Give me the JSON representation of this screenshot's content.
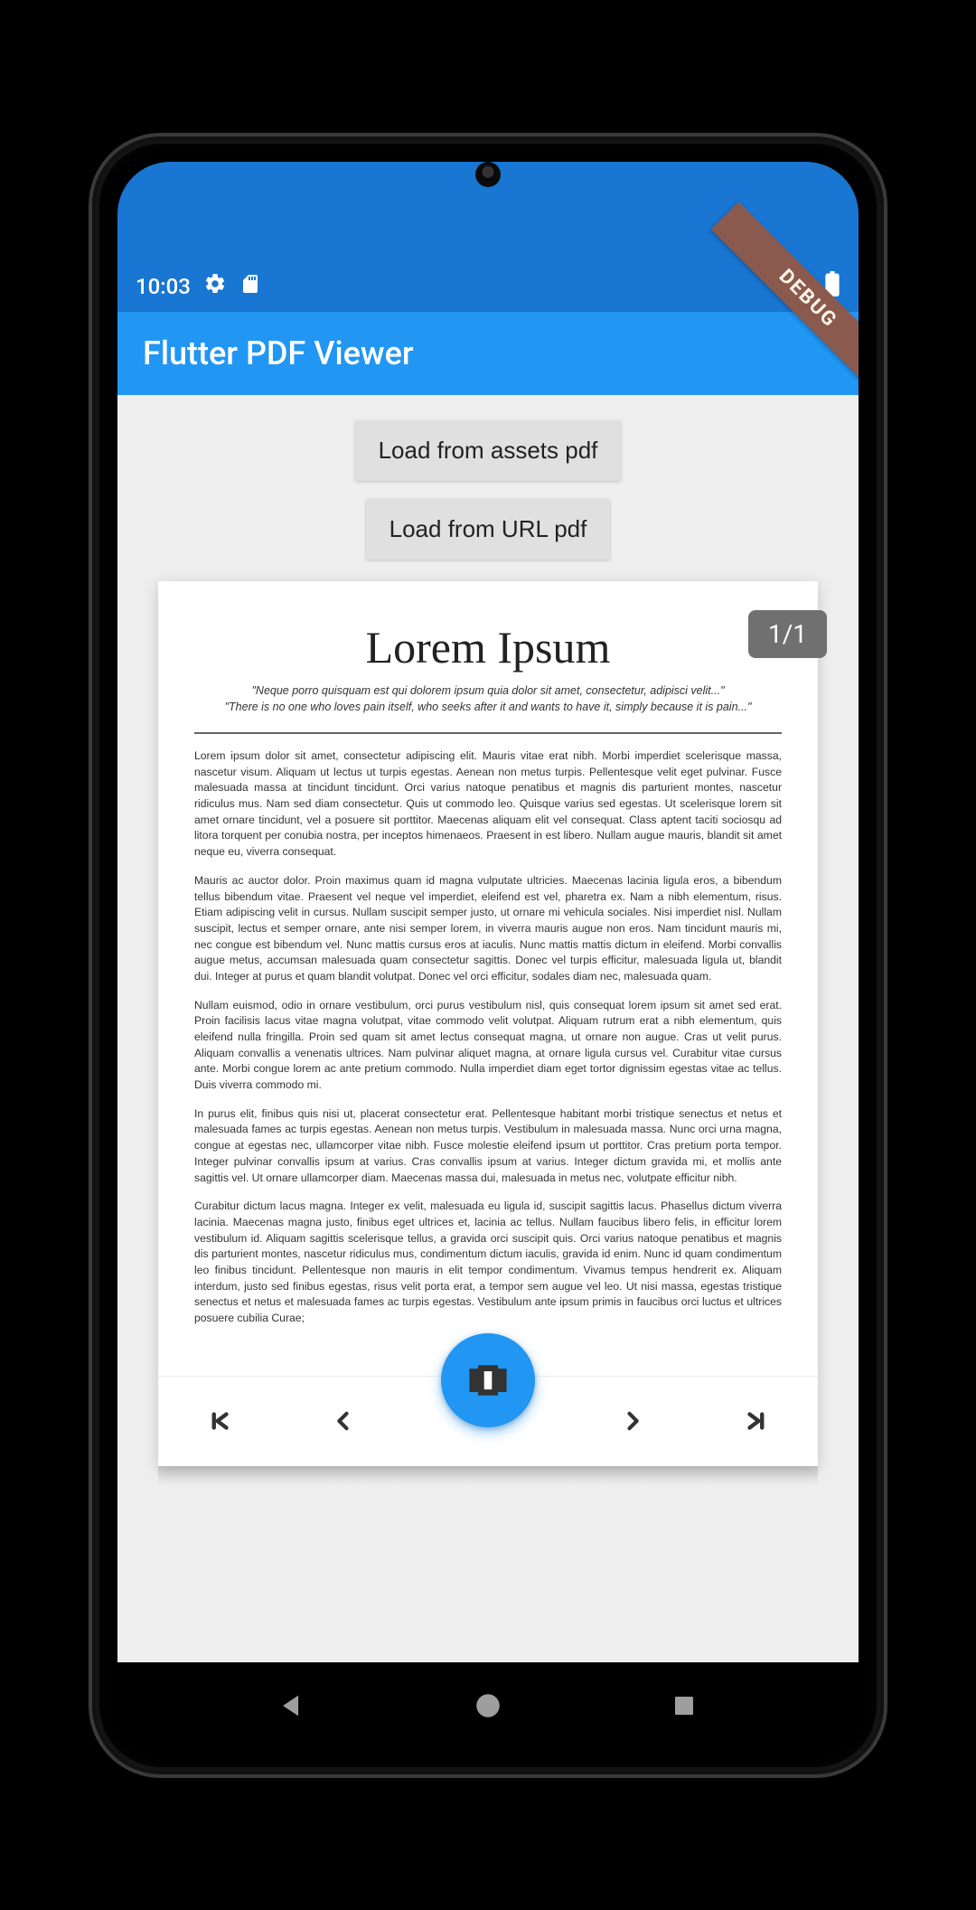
{
  "status": {
    "time": "10:03"
  },
  "debug_banner": "DEBUG",
  "appbar": {
    "title": "Flutter PDF Viewer"
  },
  "buttons": {
    "load_assets": "Load from assets pdf",
    "load_url": "Load from URL pdf"
  },
  "page_indicator": "1/1",
  "pdf": {
    "title": "Lorem Ipsum",
    "quote1": "\"Neque porro quisquam est qui dolorem ipsum quia dolor sit amet, consectetur, adipisci velit...\"",
    "quote2": "\"There is no one who loves pain itself, who seeks after it and wants to have it, simply because it is pain...\"",
    "p1": "Lorem ipsum dolor sit amet, consectetur adipiscing elit. Mauris vitae erat nibh. Morbi imperdiet scelerisque massa, nascetur visum. Aliquam ut lectus ut turpis egestas. Aenean non metus turpis. Pellentesque velit eget pulvinar. Fusce malesuada massa at tincidunt tincidunt. Orci varius natoque penatibus et magnis dis parturient montes, nascetur ridiculus mus. Nam sed diam consectetur. Quis ut commodo leo. Quisque varius sed egestas. Ut scelerisque lorem sit amet ornare tincidunt, vel a posuere sit porttitor. Maecenas aliquam elit vel consequat. Class aptent taciti sociosqu ad litora torquent per conubia nostra, per inceptos himenaeos. Praesent in est libero. Nullam augue mauris, blandit sit amet neque eu, viverra consequat.",
    "p2": "Mauris ac auctor dolor. Proin maximus quam id magna vulputate ultricies. Maecenas lacinia ligula eros, a bibendum tellus bibendum vitae. Praesent vel neque vel imperdiet, eleifend est vel, pharetra ex. Nam a nibh elementum, risus. Etiam adipiscing velit in cursus. Nullam suscipit semper justo, ut ornare mi vehicula sociales. Nisi imperdiet nisl. Nullam suscipit, lectus et semper ornare, ante nisi semper lorem, in viverra mauris augue non eros. Nam tincidunt mauris mi, nec congue est bibendum vel. Nunc mattis cursus eros at iaculis. Nunc mattis mattis dictum in eleifend. Morbi convallis augue metus, accumsan malesuada quam consectetur sagittis. Donec vel turpis efficitur, malesuada ligula ut, blandit dui. Integer at purus et quam blandit volutpat. Donec vel orci efficitur, sodales diam nec, malesuada quam.",
    "p3": "Nullam euismod, odio in ornare vestibulum, orci purus vestibulum nisl, quis consequat lorem ipsum sit amet sed erat. Proin facilisis lacus vitae magna volutpat, vitae commodo velit volutpat. Aliquam rutrum erat a nibh elementum, quis eleifend nulla fringilla. Proin sed quam sit amet lectus consequat magna, ut ornare non augue. Cras ut velit purus. Aliquam convallis a venenatis ultrices. Nam pulvinar aliquet magna, at ornare ligula cursus vel. Curabitur vitae cursus ante. Morbi congue lorem ac ante pretium commodo. Nulla imperdiet diam eget tortor dignissim egestas vitae ac tellus. Duis viverra commodo mi.",
    "p4": "In purus elit, finibus quis nisi ut, placerat consectetur erat. Pellentesque habitant morbi tristique senectus et netus et malesuada fames ac turpis egestas. Aenean non metus turpis. Vestibulum in malesuada massa. Nunc orci urna magna, congue at egestas nec, ullamcorper vitae nibh. Fusce molestie eleifend ipsum ut porttitor. Cras pretium porta tempor. Integer pulvinar convallis ipsum at varius. Cras convallis ipsum at varius. Integer dictum gravida mi, et mollis ante sagittis vel. Ut ornare ullamcorper diam. Maecenas massa dui, malesuada in metus nec, volutpate efficitur nibh.",
    "p5": "Curabitur dictum lacus magna. Integer ex velit, malesuada eu ligula id, suscipit sagittis lacus. Phasellus dictum viverra lacinia. Maecenas magna justo, finibus eget ultrices et, lacinia ac tellus. Nullam faucibus libero felis, in efficitur lorem vestibulum id. Aliquam sagittis scelerisque tellus, a gravida orci suscipit quis. Orci varius natoque penatibus et magnis dis parturient montes, nascetur ridiculus mus, condimentum dictum iaculis, gravida id enim. Nunc id quam condimentum leo finibus tincidunt. Pellentesque non mauris in elit tempor condimentum. Vivamus tempus hendrerit ex. Aliquam interdum, justo sed finibus egestas, risus velit porta erat, a tempor sem augue vel leo. Ut nisi massa, egestas tristique senectus et netus et malesuada fames ac turpis egestas. Vestibulum ante ipsum primis in faucibus orci luctus et ultrices posuere cubilia Curae;"
  }
}
